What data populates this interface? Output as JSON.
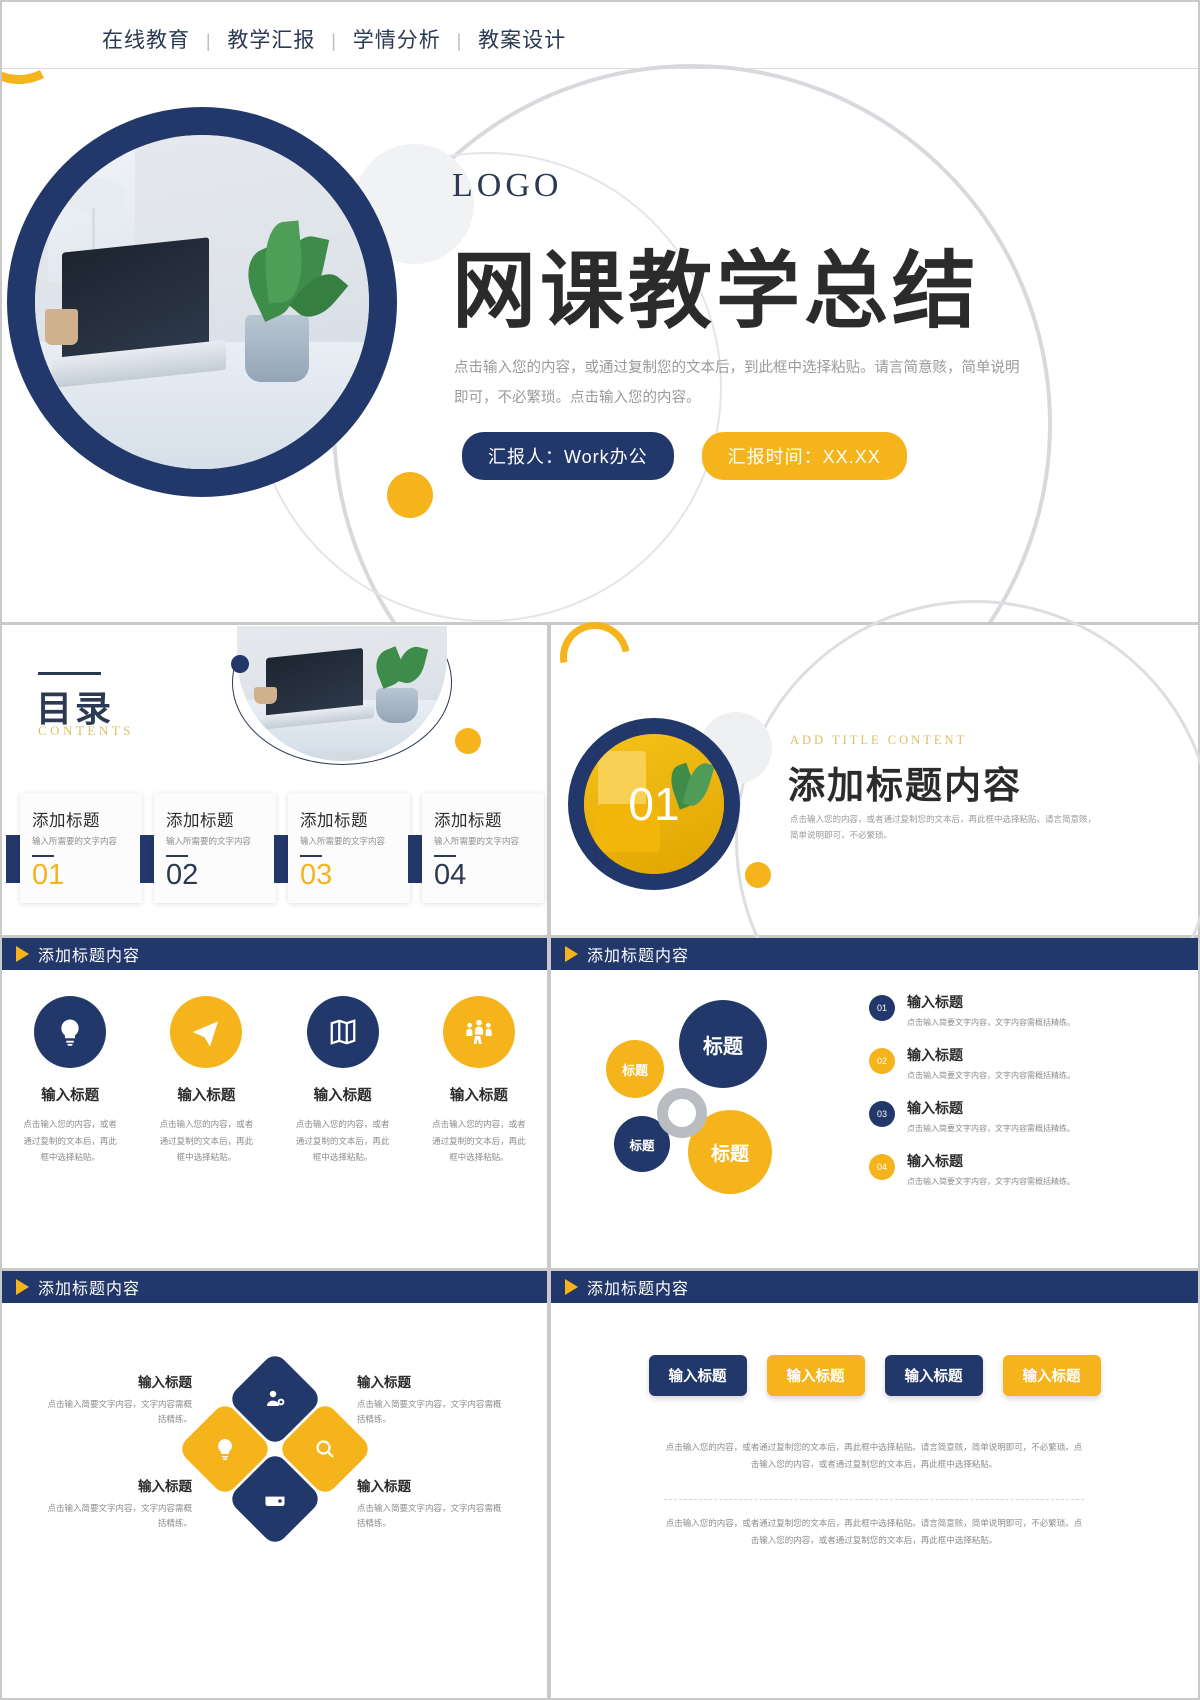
{
  "colors": {
    "navy": "#22386a",
    "gold": "#f5b41b",
    "ink": "#2b2b2b",
    "muted": "#8d8d8d"
  },
  "hero": {
    "nav": [
      "在线教育",
      "教学汇报",
      "学情分析",
      "教案设计"
    ],
    "separator": "|",
    "logo": "LOGO",
    "title": "网课教学总结",
    "description": "点击输入您的内容，或通过复制您的文本后，到此框中选择粘贴。请言简意赅，简单说明即可，不必繁琐。点击输入您的内容。",
    "badge_presenter": "汇报人：Work办公",
    "badge_time": "汇报时间：XX.XX"
  },
  "contents": {
    "title": "目录",
    "subtitle": "CONTENTS",
    "cards": [
      {
        "title": "添加标题",
        "desc": "输入所需要的文字内容",
        "num": "01"
      },
      {
        "title": "添加标题",
        "desc": "输入所需要的文字内容",
        "num": "02"
      },
      {
        "title": "添加标题",
        "desc": "输入所需要的文字内容",
        "num": "03"
      },
      {
        "title": "添加标题",
        "desc": "输入所需要的文字内容",
        "num": "04"
      }
    ]
  },
  "section_one": {
    "number": "01",
    "eyebrow": "ADD TITLE CONTENT",
    "title": "添加标题内容",
    "body": "点击输入您的内容，或者通过复制您的文本后，再此框中选择粘贴。请言简意赅，简单说明即可，不必繁琐。"
  },
  "bars": {
    "icons": "添加标题内容",
    "bubbles": "添加标题内容",
    "diamonds": "添加标题内容",
    "pills": "添加标题内容"
  },
  "icons_slide": {
    "items": [
      {
        "icon": "lightbulb-icon",
        "glyph": "💡",
        "title": "输入标题",
        "desc": "点击输入您的内容，或者通过复制的文本后，再此框中选择粘贴。"
      },
      {
        "icon": "paper-plane-icon",
        "glyph": "✈",
        "title": "输入标题",
        "desc": "点击输入您的内容，或者通过复制的文本后，再此框中选择粘贴。"
      },
      {
        "icon": "map-icon",
        "glyph": "🗺",
        "title": "输入标题",
        "desc": "点击输入您的内容，或者通过复制的文本后，再此框中选择粘贴。"
      },
      {
        "icon": "group-people-icon",
        "glyph": "👥",
        "title": "输入标题",
        "desc": "点击输入您的内容，或者通过复制的文本后，再此框中选择粘贴。"
      }
    ]
  },
  "bubbles_slide": {
    "bubbles": [
      {
        "label": "标题",
        "color": "gold",
        "size": "small"
      },
      {
        "label": "标题",
        "color": "navy",
        "size": "large"
      },
      {
        "label": "标题",
        "color": "navy",
        "size": "small"
      },
      {
        "label": "标题",
        "color": "gold",
        "size": "large"
      }
    ],
    "rows": [
      {
        "num": "01",
        "color": "navy",
        "title": "输入标题",
        "desc": "点击输入简要文字内容，文字内容需概括精练。"
      },
      {
        "num": "02",
        "color": "gold",
        "title": "输入标题",
        "desc": "点击输入简要文字内容，文字内容需概括精练。"
      },
      {
        "num": "03",
        "color": "navy",
        "title": "输入标题",
        "desc": "点击输入简要文字内容，文字内容需概括精练。"
      },
      {
        "num": "04",
        "color": "gold",
        "title": "输入标题",
        "desc": "点击输入简要文字内容，文字内容需概括精练。"
      }
    ]
  },
  "diamonds_slide": {
    "shapes": [
      {
        "icon": "user-settings-icon",
        "glyph": "👤",
        "color": "navy"
      },
      {
        "icon": "lightbulb-icon",
        "glyph": "💡",
        "color": "gold"
      },
      {
        "icon": "search-icon",
        "glyph": "🔍",
        "color": "gold"
      },
      {
        "icon": "wallet-icon",
        "glyph": "💳",
        "color": "navy"
      }
    ],
    "labels": [
      {
        "title": "输入标题",
        "desc": "点击输入简要文字内容，文字内容需概括精练。"
      },
      {
        "title": "输入标题",
        "desc": "点击输入简要文字内容，文字内容需概括精练。"
      },
      {
        "title": "输入标题",
        "desc": "点击输入简要文字内容，文字内容需概括精练。"
      },
      {
        "title": "输入标题",
        "desc": "点击输入简要文字内容，文字内容需概括精练。"
      }
    ]
  },
  "pills_slide": {
    "pills": [
      {
        "label": "输入标题",
        "color": "navy"
      },
      {
        "label": "输入标题",
        "color": "gold"
      },
      {
        "label": "输入标题",
        "color": "navy"
      },
      {
        "label": "输入标题",
        "color": "gold"
      }
    ],
    "paragraph_one": "点击输入您的内容，或者通过复制您的文本后，再此框中选择粘贴。请言简意赅，简单说明即可，不必繁琐。点击输入您的内容，或者通过复制您的文本后，再此框中选择粘贴。",
    "paragraph_two": "点击输入您的内容，或者通过复制您的文本后，再此框中选择粘贴。请言简意赅，简单说明即可，不必繁琐。点击输入您的内容，或者通过复制您的文本后，再此框中选择粘贴。"
  }
}
